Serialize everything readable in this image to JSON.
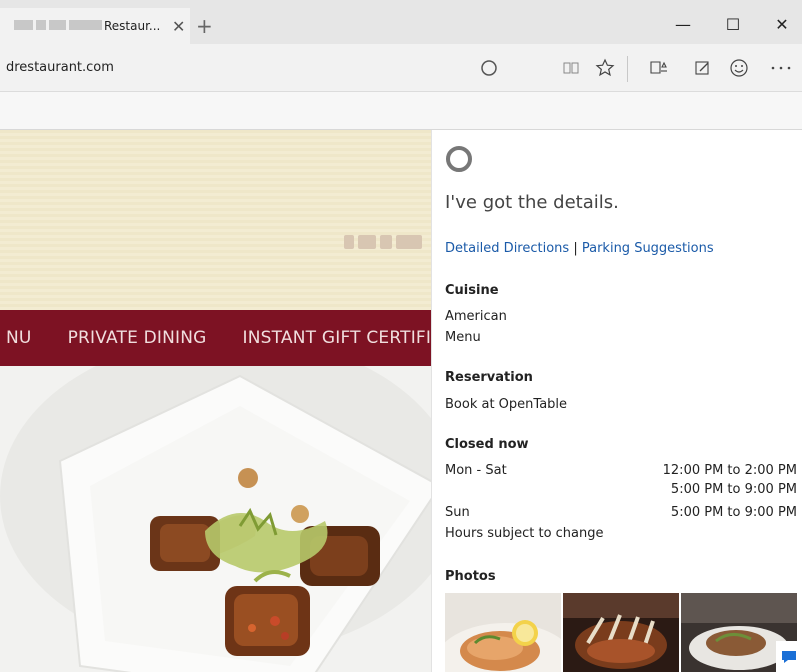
{
  "browser": {
    "tab_title": "Restaur...",
    "url": "drestaurant.com",
    "controls": {
      "minimize": "—",
      "maximize": "☐",
      "close": "✕"
    },
    "toolbar_icons": [
      "cortana-icon",
      "reading-view-icon",
      "favorite-star-icon",
      "hub-icon",
      "web-note-icon",
      "feedback-smiley-icon",
      "more-icon"
    ]
  },
  "website": {
    "nav": [
      "NU",
      "PRIVATE DINING",
      "INSTANT GIFT CERTIFICAT"
    ],
    "brand_color": "#7d1223"
  },
  "cortana": {
    "heading": "I've got the details.",
    "links": {
      "directions": "Detailed Directions",
      "separator": "|",
      "parking": "Parking Suggestions"
    },
    "cuisine": {
      "title": "Cuisine",
      "value": "American",
      "menu_link": "Menu"
    },
    "reservation": {
      "title": "Reservation",
      "link": "Book at OpenTable"
    },
    "hours": {
      "status": "Closed now",
      "rows": [
        {
          "day": "Mon - Sat",
          "times": [
            "12:00 PM to 2:00 PM",
            "5:00 PM to 9:00 PM"
          ]
        },
        {
          "day": "Sun",
          "times": [
            "5:00 PM to 9:00 PM"
          ]
        }
      ],
      "note": "Hours subject to change"
    },
    "photos": {
      "title": "Photos"
    },
    "link_color": "#1a5aa8"
  }
}
